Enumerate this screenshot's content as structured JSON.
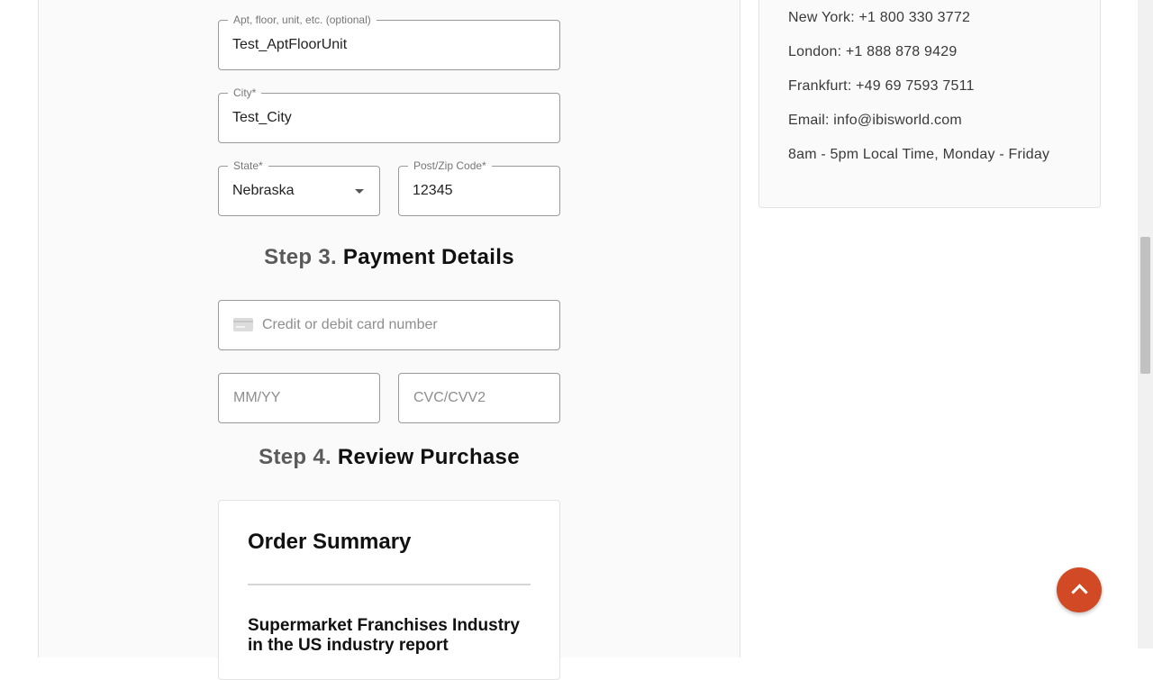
{
  "address": {
    "apt": {
      "label": "Apt, floor, unit, etc. (optional)",
      "value": "Test_AptFloorUnit"
    },
    "city": {
      "label": "City*",
      "value": "Test_City"
    },
    "state": {
      "label": "State*",
      "value": "Nebraska"
    },
    "zip": {
      "label": "Post/Zip Code*",
      "value": "12345"
    }
  },
  "step3": {
    "number": "Step 3.",
    "title": "Payment Details"
  },
  "payment": {
    "card_placeholder": "Credit or debit card number",
    "expiry_placeholder": "MM/YY",
    "cvc_placeholder": "CVC/CVV2"
  },
  "step4": {
    "number": "Step 4.",
    "title": "Review Purchase"
  },
  "summary": {
    "title": "Order Summary",
    "product": "Supermarket Franchises Industry in the US industry report"
  },
  "contact": {
    "lines": [
      "New York: +1 800 330 3772",
      "London: +1 888 878 9429",
      "Frankfurt: +49 69 7593 7511",
      "Email: info@ibisworld.com",
      "8am - 5pm Local Time, Monday - Friday"
    ]
  },
  "icons": {
    "card": "credit-card-icon",
    "caret": "chevron-down-icon",
    "scroll_top": "chevron-up-icon"
  },
  "colors": {
    "accent": "#d14a25",
    "panel_bg": "#fafafa",
    "border": "#9a9a9a"
  }
}
